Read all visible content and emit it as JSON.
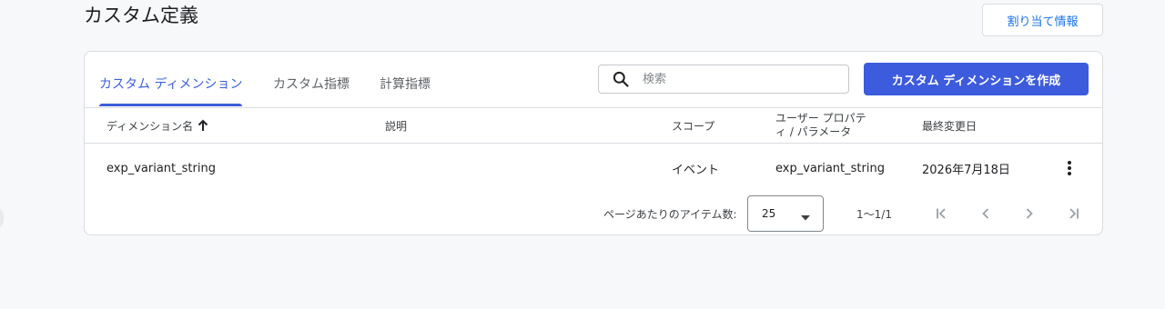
{
  "page": {
    "title": "カスタム定義",
    "attribution_button": "割り当て情報"
  },
  "tabs": [
    {
      "label": "カスタム ディメンション",
      "active": true
    },
    {
      "label": "カスタム指標",
      "active": false
    },
    {
      "label": "計算指標",
      "active": false
    }
  ],
  "search": {
    "placeholder": "検索",
    "value": ""
  },
  "create_button": "カスタム ディメンションを作成",
  "table": {
    "columns": [
      "ディメンション名",
      "説明",
      "スコープ",
      "ユーザー プロパティ / パラメータ",
      "最終変更日"
    ],
    "sort": {
      "column": "ディメンション名",
      "direction": "ascending"
    },
    "rows": [
      {
        "name": "exp_variant_string",
        "description": "",
        "scope": "イベント",
        "parameter": "exp_variant_string",
        "modified": "2026年7月18日"
      }
    ]
  },
  "pagination": {
    "items_per_page_label": "ページあたりのアイテム数:",
    "items_per_page": "25",
    "range": "1〜1/1"
  },
  "colors": {
    "accent": "#3c5bdd",
    "active_tab": "#3c5fd8",
    "background": "#f7f8fa"
  },
  "icons": [
    "search-icon",
    "sort-arrow-up-icon",
    "more-vert-icon",
    "dropdown-caret-icon",
    "first-page-icon",
    "prev-page-icon",
    "next-page-icon",
    "last-page-icon"
  ]
}
